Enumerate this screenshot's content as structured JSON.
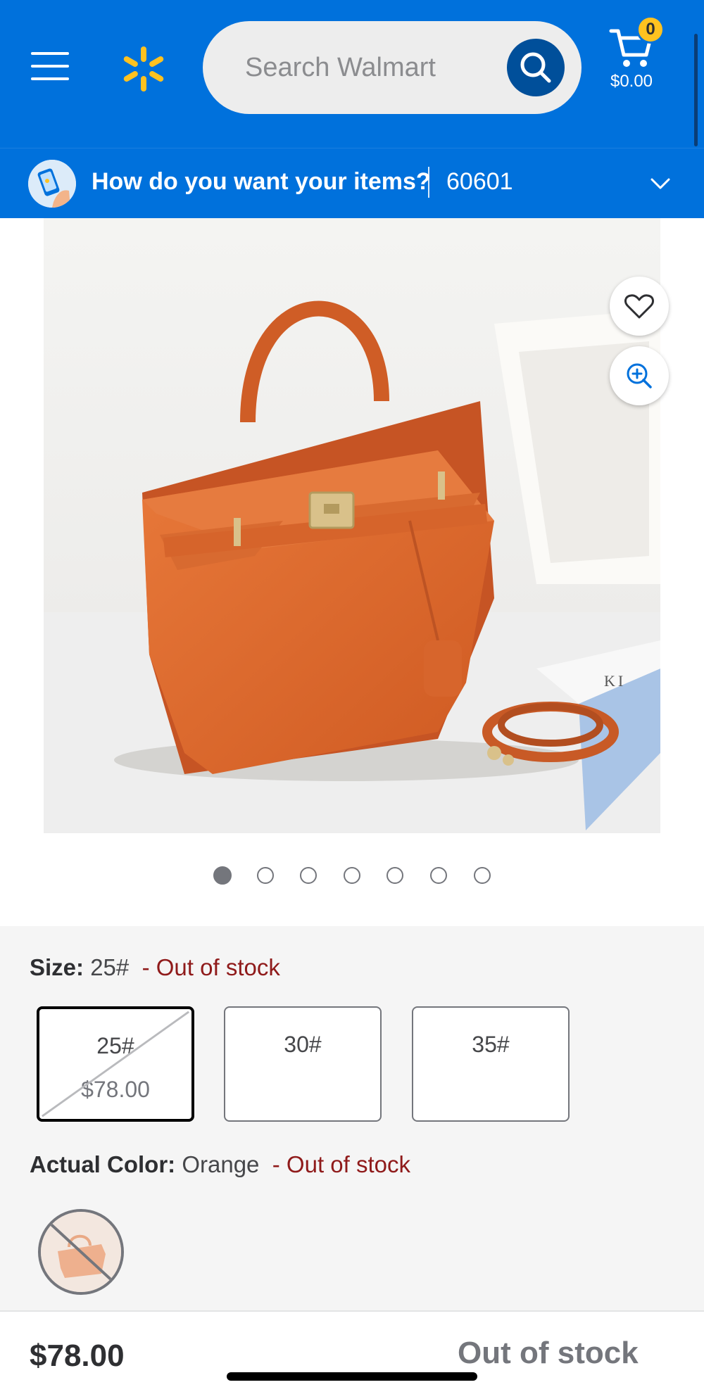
{
  "header": {
    "search_placeholder": "Search Walmart",
    "cart_count": "0",
    "cart_total": "$0.00",
    "brand_color": "#0071dc",
    "spark_color": "#ffc220"
  },
  "fulfillment": {
    "question": "How do you want your items?",
    "zip": "60601"
  },
  "gallery": {
    "image_count": 7,
    "active_index": 0
  },
  "variants": {
    "size": {
      "label": "Size:",
      "value": "25#",
      "status": "- Out of stock",
      "options": [
        {
          "name": "25#",
          "price": "$78.00",
          "selected": true,
          "unavailable": true
        },
        {
          "name": "30#",
          "price": "",
          "selected": false,
          "unavailable": false
        },
        {
          "name": "35#",
          "price": "",
          "selected": false,
          "unavailable": false
        }
      ]
    },
    "color": {
      "label": "Actual Color:",
      "value": "Orange",
      "status": "- Out of stock"
    }
  },
  "bottom_bar": {
    "price": "$78.00",
    "availability": "Out of stock"
  },
  "colors": {
    "out_of_stock_text": "#8f1a1a",
    "product_orange": "#e26a2c"
  }
}
